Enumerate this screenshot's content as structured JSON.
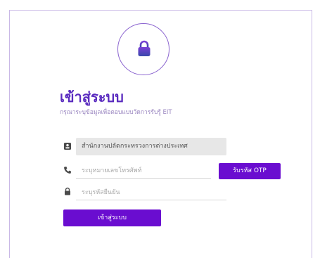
{
  "login": {
    "title": "เข้าสู่ระบบ",
    "subtitle": "กรุณาระบุข้อมูลเพื่อตอบแบบวัดการรับรู้ EIT",
    "agency_value": "สำนักงานปลัดกระทรวงการต่างประเทศ",
    "phone_placeholder": "ระบุหมายเลขโทรศัพท์",
    "otp_button_label": "รับรหัส OTP",
    "otp_placeholder": "ระบุรหัสยืนยัน",
    "submit_label": "เข้าสู่ระบบ"
  },
  "icons": {
    "lock": "lock-icon",
    "agency": "id-card-icon",
    "phone": "phone-icon",
    "otp": "lock-icon"
  },
  "colors": {
    "accent": "#6a0dd0",
    "title": "#5a2bbf",
    "border": "#c9b8e6",
    "lock_gradient_start": "#7b3fd6",
    "lock_gradient_end": "#3949ab"
  }
}
